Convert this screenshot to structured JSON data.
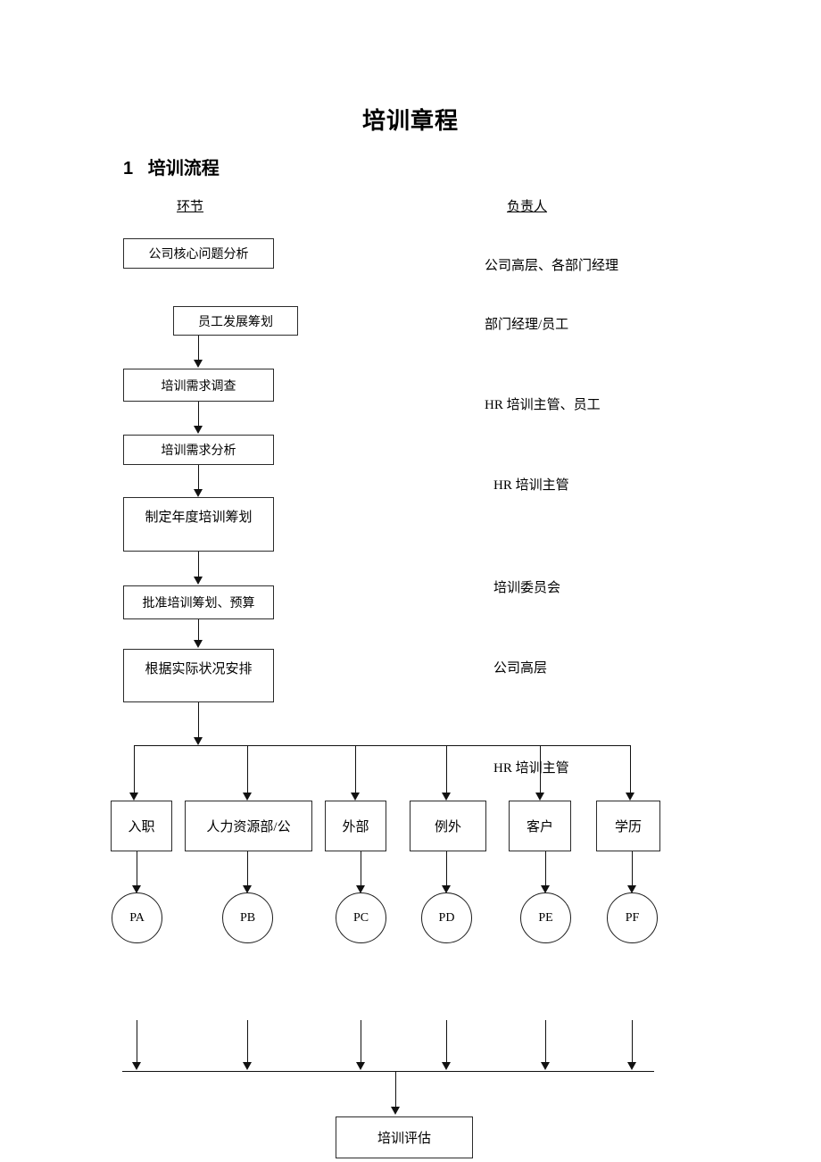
{
  "document": {
    "title": "培训章程",
    "section_number": "1",
    "section_title": "培训流程",
    "column_headers": {
      "process": "环节",
      "owner": "负责人"
    }
  },
  "flow": {
    "main_steps": [
      {
        "id": "step-1",
        "label": "公司核心问题分析"
      },
      {
        "id": "step-2",
        "label": "员工发展筹划"
      },
      {
        "id": "step-3",
        "label": "培训需求调查"
      },
      {
        "id": "step-4",
        "label": "培训需求分析"
      },
      {
        "id": "step-5",
        "label": "制定年度培训筹划"
      },
      {
        "id": "step-6",
        "label": "批准培训筹划、预算"
      },
      {
        "id": "step-7",
        "label": "根据实际状况安排"
      }
    ],
    "owners": [
      {
        "id": "owner-1",
        "label": "公司高层、各部门经理"
      },
      {
        "id": "owner-2",
        "label": "部门经理/员工"
      },
      {
        "id": "owner-3",
        "label": "HR 培训主管、员工"
      },
      {
        "id": "owner-4",
        "label": "HR 培训主管"
      },
      {
        "id": "owner-5",
        "label": "培训委员会"
      },
      {
        "id": "owner-6",
        "label": "公司高层"
      },
      {
        "id": "owner-7",
        "label": "HR 培训主管"
      }
    ],
    "branches": [
      {
        "id": "branch-a",
        "label": "入职",
        "code": "PA"
      },
      {
        "id": "branch-b",
        "label": "人力资源部/公",
        "code": "PB"
      },
      {
        "id": "branch-c",
        "label": "外部",
        "code": "PC"
      },
      {
        "id": "branch-d",
        "label": "例外",
        "code": "PD"
      },
      {
        "id": "branch-e",
        "label": "客户",
        "code": "PE"
      },
      {
        "id": "branch-f",
        "label": "学历",
        "code": "PF"
      }
    ],
    "final_step": {
      "id": "step-final",
      "label": "培训评估"
    }
  }
}
